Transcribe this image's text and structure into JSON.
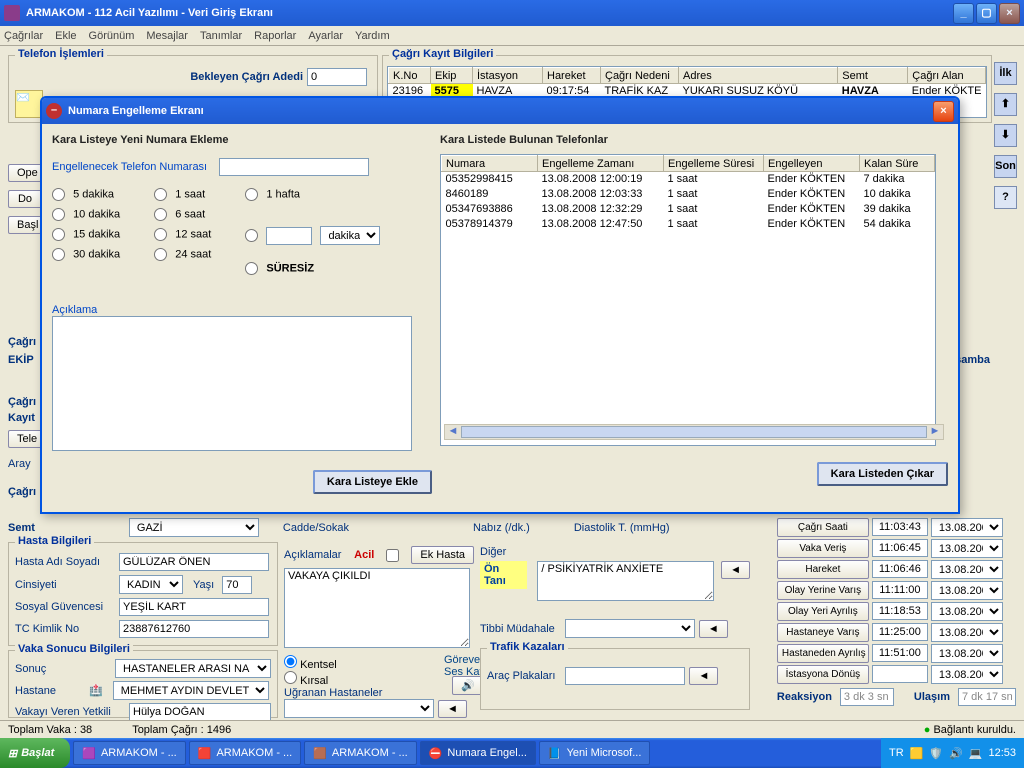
{
  "window": {
    "title": "ARMAKOM - 112 Acil Yazılımı - Veri Giriş Ekranı"
  },
  "menu": [
    "Çağrılar",
    "Ekle",
    "Görünüm",
    "Mesajlar",
    "Tanımlar",
    "Raporlar",
    "Ayarlar",
    "Yardım"
  ],
  "telefon": {
    "group": "Telefon İşlemleri",
    "bekleyen_label": "Bekleyen Çağrı Adedi",
    "bekleyen_value": "0"
  },
  "cagri_kayit": {
    "group": "Çağrı Kayıt Bilgileri",
    "headers": [
      "K.No",
      "Ekip",
      "İstasyon",
      "Hareket",
      "Çağrı Nedeni",
      "Adres",
      "Semt",
      "Çağrı Alan"
    ],
    "row": [
      "23196",
      "5575",
      "HAVZA",
      "09:17:54",
      "TRAFİK KAZ",
      "YUKARI SUSUZ KÖYÜ",
      "HAVZA",
      "Ender KÖKTE"
    ]
  },
  "side_buttons": {
    "ilk": "İlk",
    "up": "⬆",
    "down": "⬇",
    "son": "Son",
    "q": "?"
  },
  "modal": {
    "title": "Numara Engelleme Ekranı",
    "left_heading": "Kara Listeye Yeni Numara Ekleme",
    "phone_label": "Engellenecek Telefon Numarası",
    "radios_col1": [
      "5 dakika",
      "10 dakika",
      "15 dakika",
      "30 dakika"
    ],
    "radios_col2": [
      "1 saat",
      "6 saat",
      "12 saat",
      "24 saat"
    ],
    "radios_col3": [
      "1 hafta",
      "",
      "",
      "SÜRESİZ"
    ],
    "custom_unit": "dakika",
    "aciklama_label": "Açıklama",
    "add_btn": "Kara Listeye Ekle",
    "right_heading": "Kara Listede Bulunan Telefonlar",
    "list_headers": [
      "Numara",
      "Engelleme Zamanı",
      "Engelleme Süresi",
      "Engelleyen",
      "Kalan Süre"
    ],
    "rows": [
      [
        "05352998415",
        "13.08.2008 12:00:19",
        "1 saat",
        "Ender KÖKTEN",
        "7 dakika"
      ],
      [
        "8460189",
        "13.08.2008 12:03:33",
        "1 saat",
        "Ender KÖKTEN",
        "10 dakika"
      ],
      [
        "05347693886",
        "13.08.2008 12:32:29",
        "1 saat",
        "Ender KÖKTEN",
        "39 dakika"
      ],
      [
        "05378914379",
        "13.08.2008 12:47:50",
        "1 saat",
        "Ender KÖKTEN",
        "54 dakika"
      ]
    ],
    "remove_btn": "Kara Listeden Çıkar"
  },
  "hasta": {
    "group": "Hasta Bilgileri",
    "ad_label": "Hasta Adı Soyadı",
    "ad": "GÜLÜZAR ÖNEN",
    "cinsiyet_label": "Cinsiyeti",
    "cinsiyet": "KADIN",
    "yasi_label": "Yaşı",
    "yasi": "70",
    "sosyal_label": "Sosyal Güvencesi",
    "sosyal": "YEŞİL KART",
    "tc_label": "TC Kimlik No",
    "tc": "23887612760"
  },
  "sonuc": {
    "group": "Vaka Sonucu Bilgileri",
    "sonuc_label": "Sonuç",
    "sonuc": "HASTANELER ARASI NA",
    "hastane_label": "Hastane",
    "hastane": "MEHMET AYDIN DEVLET",
    "yetkili_label": "Vakayı Veren Yetkili",
    "yetkili": "Hülya DOĞAN"
  },
  "aciklamalar": {
    "label": "Açıklamalar",
    "acil": "Acil",
    "ekhasta": "Ek Hasta",
    "text": "VAKAYA ÇIKILDI",
    "kentsel": "Kentsel",
    "kirsal": "Kırsal",
    "ugranan": "Uğranan Hastaneler",
    "gorev": "Göreve Ait\nSes Kayıtları"
  },
  "on_tani": {
    "label": "Ön Tanı",
    "diger": "Diğer",
    "text": "/ PSİKİYATRİK ANXİETE",
    "tibbi": "Tibbi Müdahale"
  },
  "trafik": {
    "group": "Trafik Kazaları",
    "plaka": "Araç Plakaları"
  },
  "times": {
    "items": [
      {
        "label": "Çağrı Saati",
        "time": "11:03:43",
        "date": "13.08.2008"
      },
      {
        "label": "Vaka Veriş",
        "time": "11:06:45",
        "date": "13.08.2008"
      },
      {
        "label": "Hareket",
        "time": "11:06:46",
        "date": "13.08.2008"
      },
      {
        "label": "Olay Yerine Varış",
        "time": "11:11:00",
        "date": "13.08.2008"
      },
      {
        "label": "Olay Yeri Ayrılış",
        "time": "11:18:53",
        "date": "13.08.2008"
      },
      {
        "label": "Hastaneye Varış",
        "time": "11:25:00",
        "date": "13.08.2008"
      },
      {
        "label": "Hastaneden Ayrılış",
        "time": "11:51:00",
        "date": "13.08.2008"
      },
      {
        "label": "İstasyona Dönüş",
        "time": "",
        "date": "13.08.2008"
      }
    ],
    "reaksiyon_label": "Reaksiyon",
    "reaksiyon": "3 dk 3 sn",
    "ulasim_label": "Ulaşım",
    "ulasim": "7 dk 17 sn"
  },
  "left_strip": {
    "cagri_label": "Çağrı",
    "ekip": "EKİP",
    "kayit": "Kayıt",
    "tele": "Tele",
    "aray": "Aray",
    "semt": "Semt",
    "gazi": "GAZİ"
  },
  "top_buttons": [
    "Ope",
    "Do",
    "Başl"
  ],
  "extra": {
    "cadde": "Cadde/Sokak",
    "nabiz": "Nabız (/dk.)",
    "diastolik": "Diastolik T. (mmHg)"
  },
  "status": {
    "vaka": "Toplam Vaka : 38",
    "cagri": "Toplam Çağrı : 1496",
    "baglanti": "Bağlantı kuruldu."
  },
  "taskbar": {
    "start": "Başlat",
    "tasks": [
      "ARMAKOM - ...",
      "ARMAKOM - ...",
      "ARMAKOM - ...",
      "Numara Engel...",
      "Yeni Microsof..."
    ],
    "lang": "TR",
    "clock": "12:53"
  },
  "day_label": "şamba"
}
